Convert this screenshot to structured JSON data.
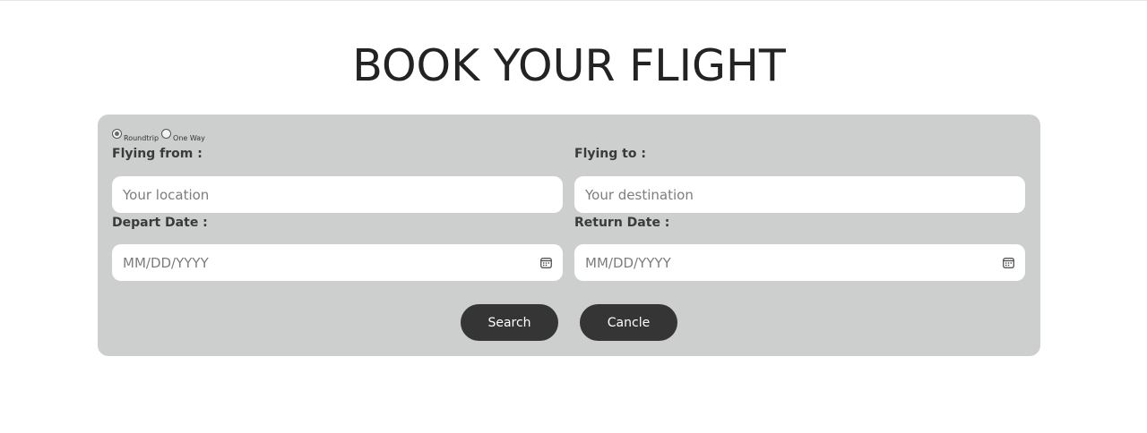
{
  "page": {
    "title": "BOOK YOUR FLIGHT"
  },
  "trip_type": {
    "options": [
      {
        "label": "Roundtrip",
        "checked": true
      },
      {
        "label": "One Way",
        "checked": false
      }
    ]
  },
  "form": {
    "from_label": "Flying from :",
    "from_placeholder": "Your location",
    "to_label": "Flying to :",
    "to_placeholder": "Your destination",
    "depart_label": "Depart Date :",
    "depart_placeholder": "MM/DD/YYYY",
    "return_label": "Return Date :",
    "return_placeholder": "MM/DD/YYYY"
  },
  "actions": {
    "search_label": "Search",
    "cancel_label": "Cancle"
  },
  "icons": {
    "date_picker": "calendar-icon"
  },
  "colors": {
    "card_background": "#cdcfce",
    "button_background": "#353535",
    "button_text": "#ffffff",
    "title_text": "#232323"
  }
}
